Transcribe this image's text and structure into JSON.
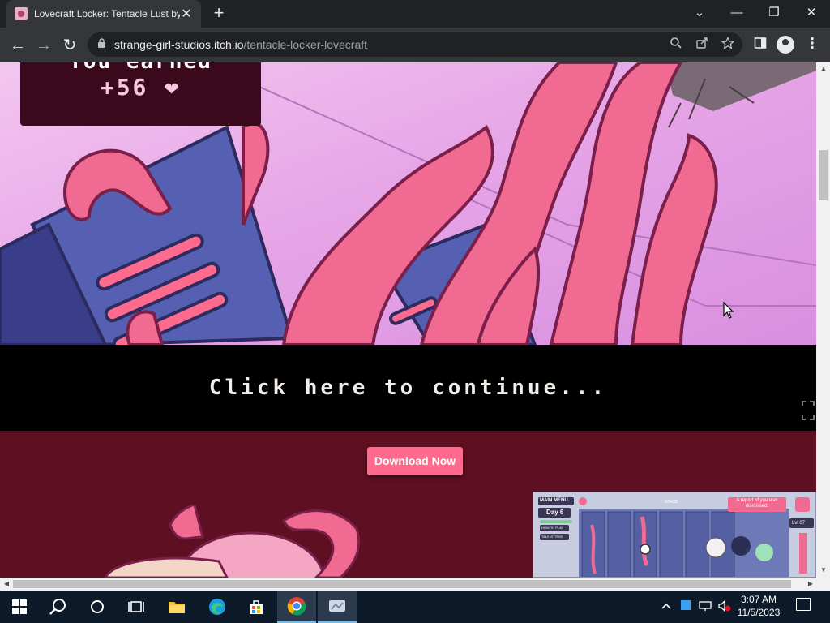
{
  "browser": {
    "tab_title": "Lovecraft Locker: Tentacle Lust by",
    "tab_close": "✕",
    "new_tab": "+",
    "url_host": "strange-girl-studios.itch.io",
    "url_path": "/tentacle-locker-lovecraft",
    "window_controls": {
      "dropdown": "⌄",
      "minimize": "—",
      "maximize": "❐",
      "close": "✕"
    },
    "nav": {
      "back": "←",
      "forward": "→",
      "reload": "↻"
    }
  },
  "page": {
    "earned_label": "You earned",
    "earned_value": "+56 ❤",
    "continue_text": "Click here to continue...",
    "download_label": "Download Now",
    "thumb": {
      "main_menu": "MAIN MENU",
      "day": "Day 6",
      "how_to_play": "HOW TO PLAY",
      "talent_tree": "TALENT TREE",
      "space": "SPACE",
      "report": "A report of you was dismissed!",
      "level": "Lvl 07"
    },
    "accent": "#ff6b8e"
  },
  "taskbar": {
    "time": "3:07 AM",
    "date": "11/5/2023"
  }
}
